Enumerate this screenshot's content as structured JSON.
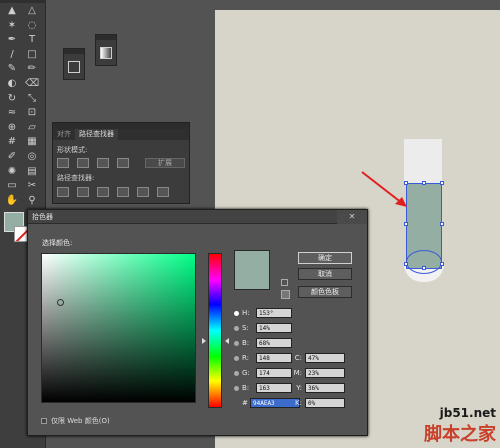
{
  "toolbar": {
    "tools": [
      "selection-tool",
      "direct-selection-tool",
      "magic-wand-tool",
      "lasso-tool",
      "pen-tool",
      "type-tool",
      "line-tool",
      "rectangle-tool",
      "paintbrush-tool",
      "pencil-tool",
      "blob-brush-tool",
      "eraser-tool",
      "rotate-tool",
      "scale-tool",
      "width-tool",
      "free-transform-tool",
      "shape-builder-tool",
      "perspective-tool",
      "mesh-tool",
      "gradient-tool",
      "eyedropper-tool",
      "blend-tool",
      "symbol-sprayer-tool",
      "graph-tool",
      "artboard-tool",
      "slice-tool",
      "hand-tool",
      "zoom-tool"
    ],
    "fill_color": "#94aea3",
    "stroke_color": "#ffffff"
  },
  "pathfinder": {
    "tabs": [
      "对齐",
      "路径查找器"
    ],
    "shape_modes_label": "形状模式:",
    "pathfinders_label": "路径查找器:",
    "expand_label": "扩展"
  },
  "color_picker": {
    "title": "拾色器",
    "close_symbol": "✕",
    "select_color_label": "选择颜色:",
    "ok_label": "确定",
    "cancel_label": "取消",
    "swatches_label": "颜色色板",
    "web_only_label": "仅限 Web 颜色(O)",
    "current_color": "#94aea3",
    "hsb": [
      {
        "label": "H:",
        "value": "153°",
        "selected": true
      },
      {
        "label": "S:",
        "value": "14%",
        "selected": false
      },
      {
        "label": "B:",
        "value": "68%",
        "selected": false
      }
    ],
    "rgb": [
      {
        "label": "R:",
        "value": "148"
      },
      {
        "label": "G:",
        "value": "174"
      },
      {
        "label": "B:",
        "value": "163"
      }
    ],
    "cmyk": [
      {
        "label": "C:",
        "value": "47%"
      },
      {
        "label": "M:",
        "value": "23%"
      },
      {
        "label": "Y:",
        "value": "36%"
      },
      {
        "label": "K:",
        "value": "0%"
      }
    ],
    "hex_label": "#",
    "hex_value": "94AEA3"
  },
  "canvas": {
    "artboard_color": "#d7d4c9",
    "shape_fill": "#94aea3",
    "arrow_color": "#e02020"
  },
  "watermark": {
    "domain": "jb51.net",
    "name": "脚本之家"
  }
}
